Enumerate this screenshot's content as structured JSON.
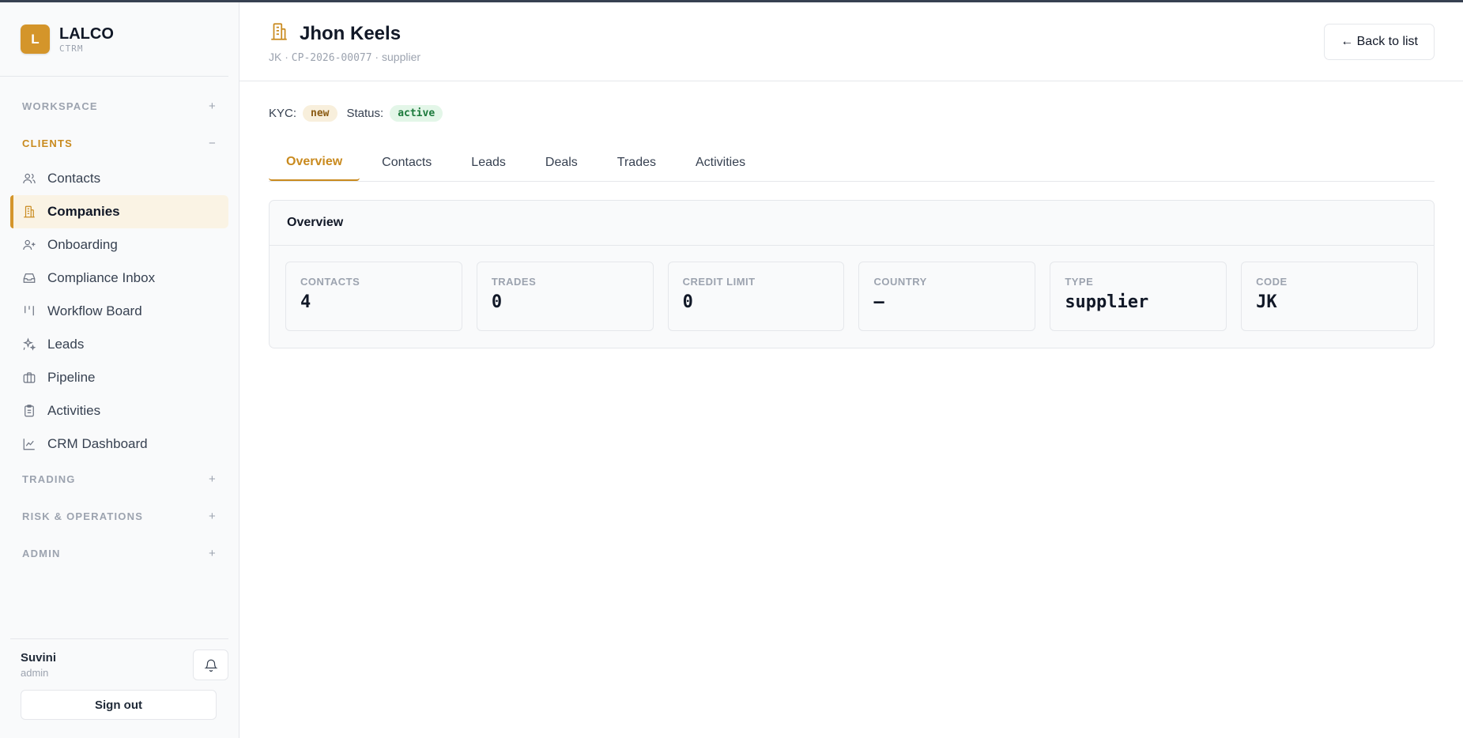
{
  "brand": {
    "logo_letter": "L",
    "name": "LALCO",
    "sub": "CTRM"
  },
  "sidebar": {
    "sections": [
      {
        "label": "WORKSPACE",
        "toggle": "+"
      },
      {
        "label": "CLIENTS",
        "toggle": "−"
      },
      {
        "label": "TRADING",
        "toggle": "+"
      },
      {
        "label": "RISK & OPERATIONS",
        "toggle": "+"
      },
      {
        "label": "ADMIN",
        "toggle": "+"
      }
    ],
    "items": [
      {
        "label": "Contacts",
        "icon": "users-icon"
      },
      {
        "label": "Companies",
        "icon": "building-icon",
        "active": true
      },
      {
        "label": "Onboarding",
        "icon": "user-plus-icon"
      },
      {
        "label": "Compliance Inbox",
        "icon": "inbox-icon"
      },
      {
        "label": "Workflow Board",
        "icon": "kanban-icon"
      },
      {
        "label": "Leads",
        "icon": "sparkles-icon"
      },
      {
        "label": "Pipeline",
        "icon": "briefcase-icon"
      },
      {
        "label": "Activities",
        "icon": "clipboard-icon"
      },
      {
        "label": "CRM Dashboard",
        "icon": "line-chart-icon"
      }
    ]
  },
  "user": {
    "name": "Suvini",
    "role": "admin",
    "signout_label": "Sign out"
  },
  "header": {
    "title": "Jhon Keels",
    "code": "JK",
    "ref": "CP-2026-00077",
    "type": "supplier",
    "back_label": "← Back to list"
  },
  "badges": {
    "kyc_label": "KYC:",
    "kyc_value": "new",
    "status_label": "Status:",
    "status_value": "active"
  },
  "tabs": [
    "Overview",
    "Contacts",
    "Leads",
    "Deals",
    "Trades",
    "Activities"
  ],
  "overview": {
    "title": "Overview",
    "stats": [
      {
        "label": "CONTACTS",
        "value": "4"
      },
      {
        "label": "TRADES",
        "value": "0"
      },
      {
        "label": "CREDIT LIMIT",
        "value": "0"
      },
      {
        "label": "COUNTRY",
        "value": "—"
      },
      {
        "label": "TYPE",
        "value": "supplier"
      },
      {
        "label": "CODE",
        "value": "JK"
      }
    ]
  },
  "colors": {
    "accent": "#d4952a",
    "accent_text": "#c98a1e",
    "kyc_bg": "#f8efdc",
    "status_bg": "#e3f6e8"
  }
}
